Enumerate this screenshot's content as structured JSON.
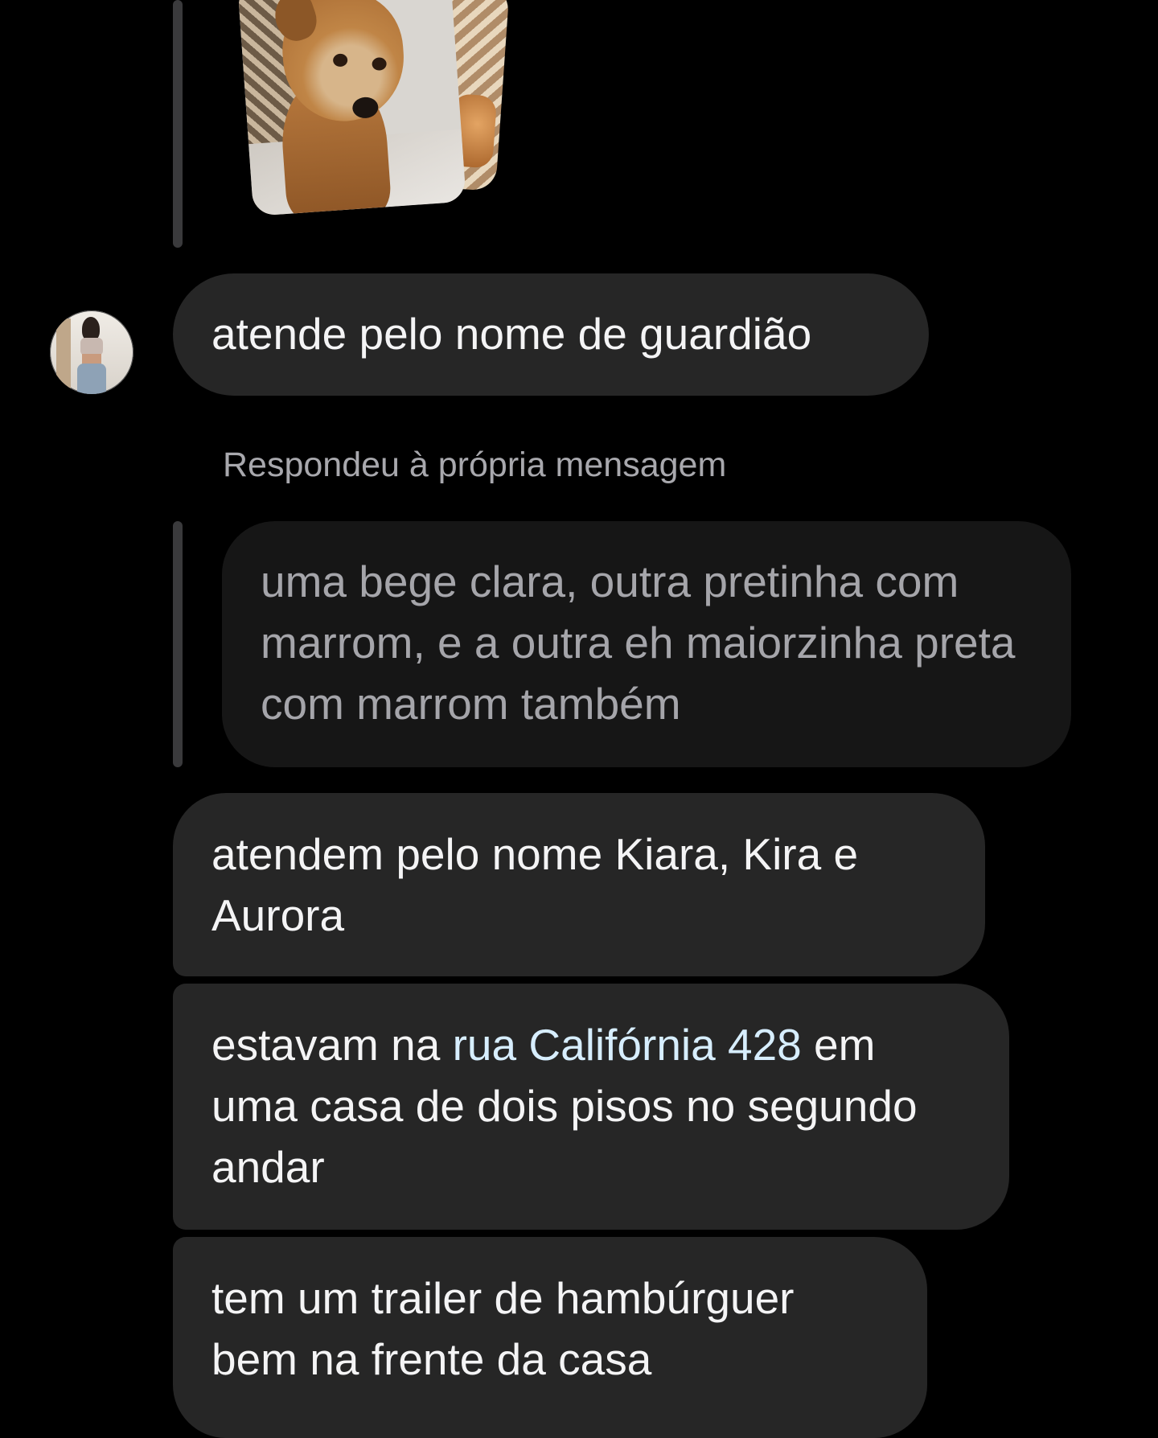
{
  "conversation": {
    "reply_label": "Respondeu à própria mensagem",
    "messages": [
      {
        "text": "atende pelo nome de guardião"
      },
      {
        "text": "uma bege clara, outra pretinha com marrom, e a outra eh maiorzinha preta com marrom também",
        "quoted": true
      },
      {
        "text": "atendem pelo nome Kiara, Kira e Aurora"
      },
      {
        "prefix": "estavam na ",
        "link": "rua Califórnia 428",
        "suffix": " em uma casa de dois pisos no segundo andar"
      },
      {
        "text": "tem um trailer de hambúrguer bem na frente da casa"
      }
    ]
  },
  "colors": {
    "background": "#000000",
    "bubble": "#262626",
    "quoted_bubble": "#161616",
    "link": "#d7eeff",
    "reply_bar": "#3a3a3c"
  },
  "icons": {
    "avatar": "user-avatar-photo",
    "shared_media": "dog-photo-stack"
  }
}
